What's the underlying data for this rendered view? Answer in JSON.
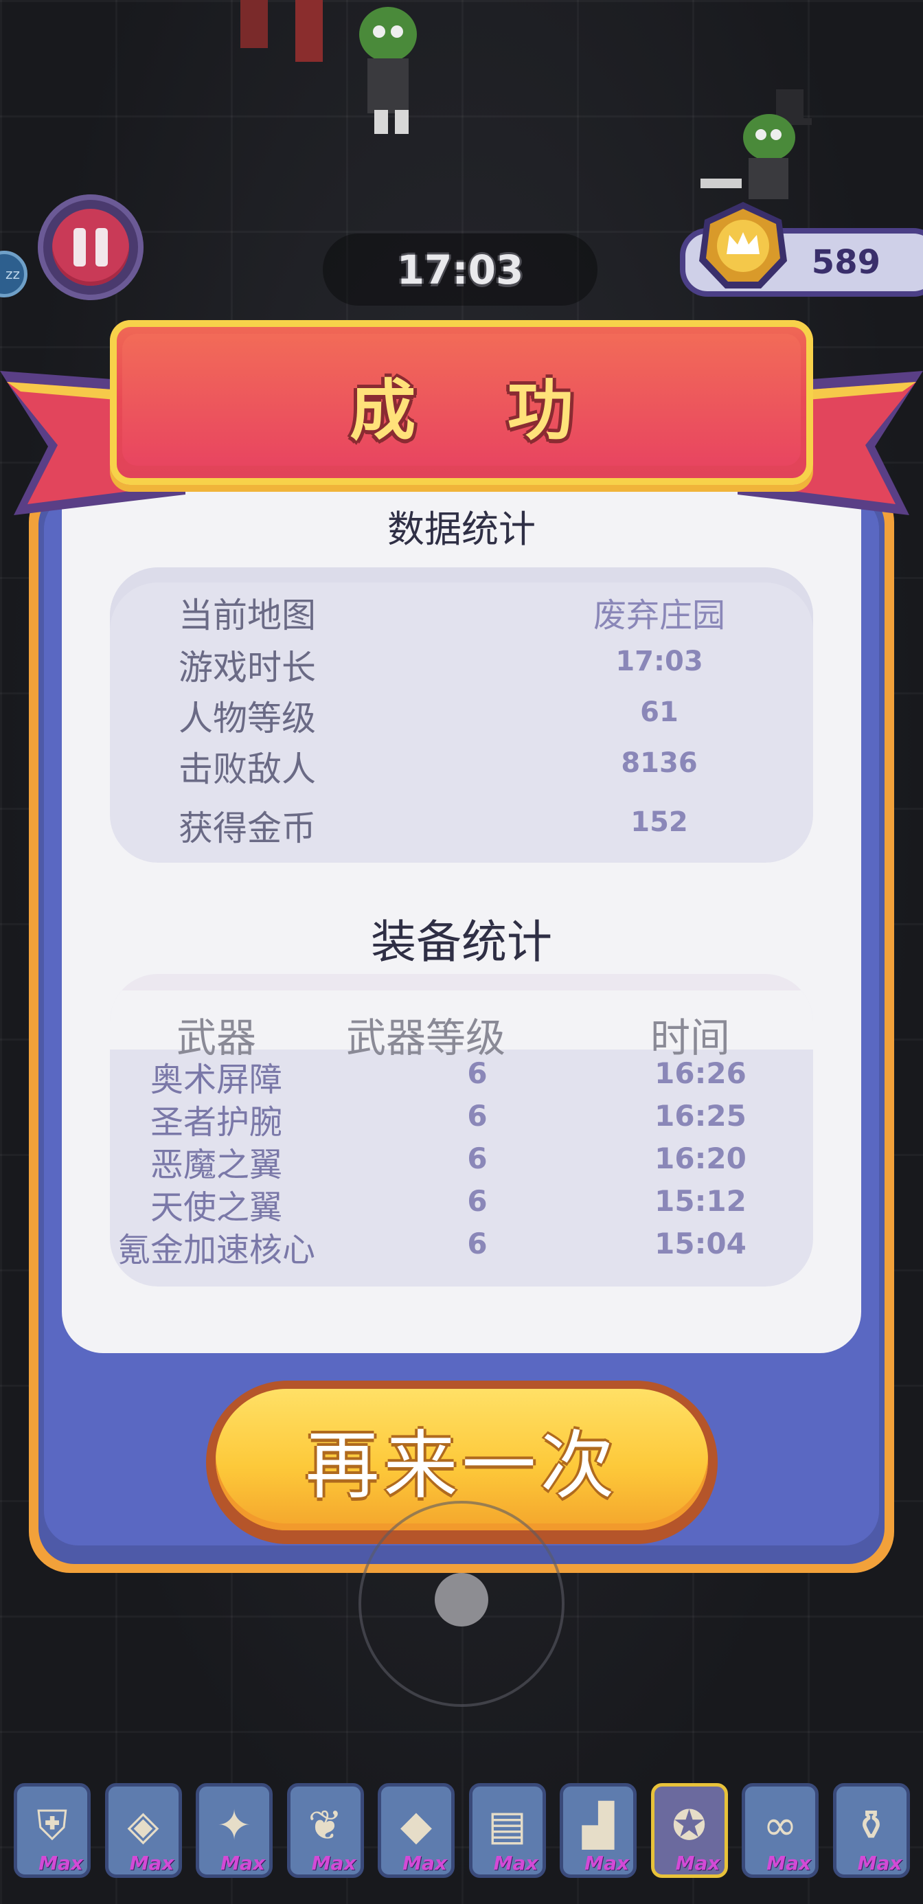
{
  "hud": {
    "timer": "17:03",
    "score": "589",
    "side_badge": "zz"
  },
  "result": {
    "title": "成 功",
    "stats_title": "数据统计",
    "stats": [
      {
        "label": "当前地图",
        "value": "废弃庄园"
      },
      {
        "label": "游戏时长",
        "value": "17:03"
      },
      {
        "label": "人物等级",
        "value": "61"
      },
      {
        "label": "击败敌人",
        "value": "8136"
      },
      {
        "label": "获得金币",
        "value": "152"
      }
    ],
    "equip_title": "装备统计",
    "equip_headers": {
      "weapon": "武器",
      "level": "武器等级",
      "time": "时间"
    },
    "equipment": [
      {
        "name": "奥术屏障",
        "level": "6",
        "time": "16:26"
      },
      {
        "name": "圣者护腕",
        "level": "6",
        "time": "16:25"
      },
      {
        "name": "恶魔之翼",
        "level": "6",
        "time": "16:20"
      },
      {
        "name": "天使之翼",
        "level": "6",
        "time": "15:12"
      },
      {
        "name": "氪金加速核心",
        "level": "6",
        "time": "15:04"
      }
    ],
    "retry_label": "再来一次"
  },
  "items": [
    {
      "icon": "shield-emblem-icon",
      "glyph": "⛨",
      "badge": "Max"
    },
    {
      "icon": "bracer-icon",
      "glyph": "◈",
      "badge": "Max"
    },
    {
      "icon": "demon-wings-icon",
      "glyph": "✦",
      "badge": "Max"
    },
    {
      "icon": "angel-wings-icon",
      "glyph": "❦",
      "badge": "Max"
    },
    {
      "icon": "crystal-icon",
      "glyph": "◆",
      "badge": "Max"
    },
    {
      "icon": "book-icon",
      "glyph": "▤",
      "badge": "Max"
    },
    {
      "icon": "boot-icon",
      "glyph": "▟",
      "badge": "Max"
    },
    {
      "icon": "core-icon",
      "glyph": "✪",
      "badge": "Max"
    },
    {
      "icon": "rope-icon",
      "glyph": "∞",
      "badge": "Max"
    },
    {
      "icon": "potion-icon",
      "glyph": "⚱",
      "badge": "Max"
    }
  ]
}
